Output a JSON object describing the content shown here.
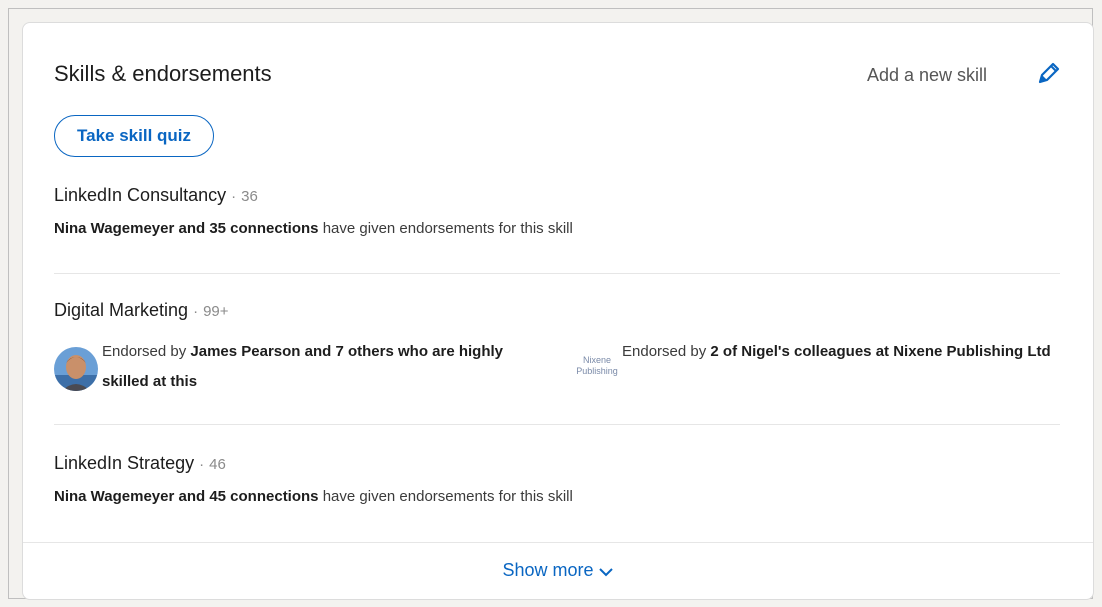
{
  "header": {
    "title": "Skills & endorsements",
    "add_skill_label": "Add a new skill"
  },
  "quiz_button_label": "Take skill quiz",
  "skills": [
    {
      "name": "LinkedIn Consultancy",
      "separator": "·",
      "count": "36",
      "endorsement": {
        "bold": "Nina Wagemeyer and 35 connections",
        "rest": "have given endorsements for this skill"
      }
    },
    {
      "name": "Digital Marketing",
      "separator": "·",
      "count": "99+",
      "endorsed_by_prefix": "Endorsed by",
      "endorsed_by_bold": "James Pearson and 7 others who are highly skilled at this",
      "colleagues_prefix": "Endorsed by",
      "colleagues_bold": "2 of Nigel's colleagues at Nixene Publishing Ltd",
      "company_logo_text": "Nixene Publishing"
    },
    {
      "name": "LinkedIn Strategy",
      "separator": "·",
      "count": "46",
      "endorsement": {
        "bold": "Nina Wagemeyer and 45 connections",
        "rest": "have given endorsements for this skill"
      }
    }
  ],
  "footer": {
    "show_more_label": "Show more"
  },
  "colors": {
    "accent": "#0a66c2",
    "text": "#1d1d1d",
    "muted": "#8a8a8a"
  },
  "icons": {
    "edit": "pencil-icon",
    "expand": "chevron-down-icon"
  }
}
